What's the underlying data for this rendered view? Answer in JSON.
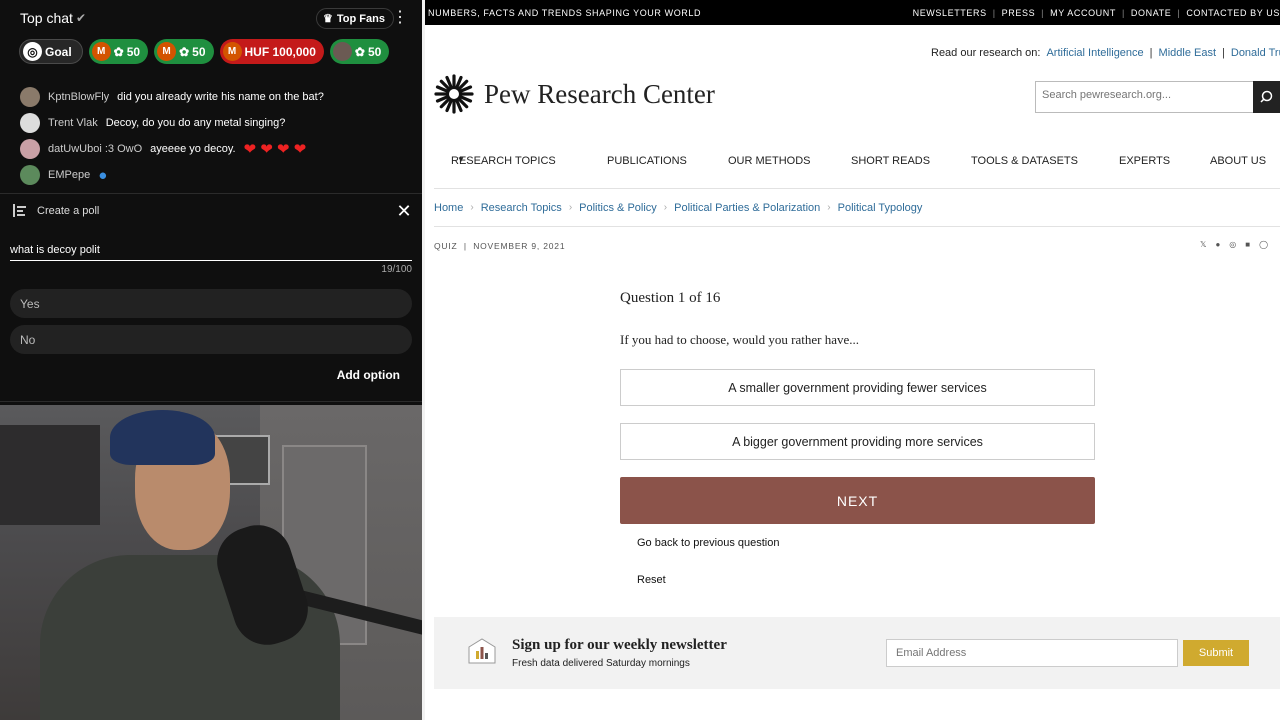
{
  "chat": {
    "title": "Top chat",
    "top_fans_label": "Top Fans",
    "pills": [
      {
        "label": "Goal"
      },
      {
        "avatar": "M",
        "value": "50"
      },
      {
        "avatar": "M",
        "value": "50"
      },
      {
        "avatar": "M",
        "value": "HUF 100,000"
      },
      {
        "value": "50"
      }
    ],
    "messages": [
      {
        "name": "KptnBlowFly",
        "text": "did you already write his name on the bat?"
      },
      {
        "name": "Trent Vlak",
        "text": "Decoy, do you do any metal singing?"
      },
      {
        "name": "datUwUboi :3 OwO",
        "text": "ayeeee yo decoy."
      },
      {
        "name": "EMPepe",
        "text": ""
      }
    ],
    "poll": {
      "title": "Create a poll",
      "question_value": "what is decoy polit",
      "counter": "19/100",
      "options": [
        "Yes",
        "No"
      ],
      "add_option": "Add option"
    }
  },
  "site": {
    "topbar_tagline": "NUMBERS, FACTS AND TRENDS SHAPING YOUR WORLD",
    "topbar_links": [
      "NEWSLETTERS",
      "PRESS",
      "MY ACCOUNT",
      "DONATE",
      "CONTACTED BY US"
    ],
    "read_on_label": "Read our research on:",
    "read_on_links": [
      "Artificial Intelligence",
      "Middle East",
      "Donald Trump"
    ],
    "logo_text": "Pew Research Center",
    "search_placeholder": "Search pewresearch.org...",
    "nav": [
      "RESEARCH TOPICS",
      "PUBLICATIONS",
      "OUR METHODS",
      "SHORT READS",
      "TOOLS & DATASETS",
      "EXPERTS",
      "ABOUT US"
    ],
    "breadcrumbs": [
      "Home",
      "Research Topics",
      "Politics & Policy",
      "Political Parties & Polarization",
      "Political Typology"
    ],
    "meta_type": "QUIZ",
    "meta_date": "NOVEMBER 9, 2021",
    "quiz": {
      "question_number": "Question 1 of 16",
      "question_text": "If you had to choose, would you rather have...",
      "answers": [
        "A smaller government providing fewer services",
        "A bigger government providing more services"
      ],
      "next_label": "NEXT",
      "back_label": "Go back to previous question",
      "reset_label": "Reset"
    },
    "newsletter": {
      "title": "Sign up for our weekly newsletter",
      "subtitle": "Fresh data delivered Saturday mornings",
      "email_placeholder": "Email Address",
      "submit_label": "Submit"
    }
  }
}
